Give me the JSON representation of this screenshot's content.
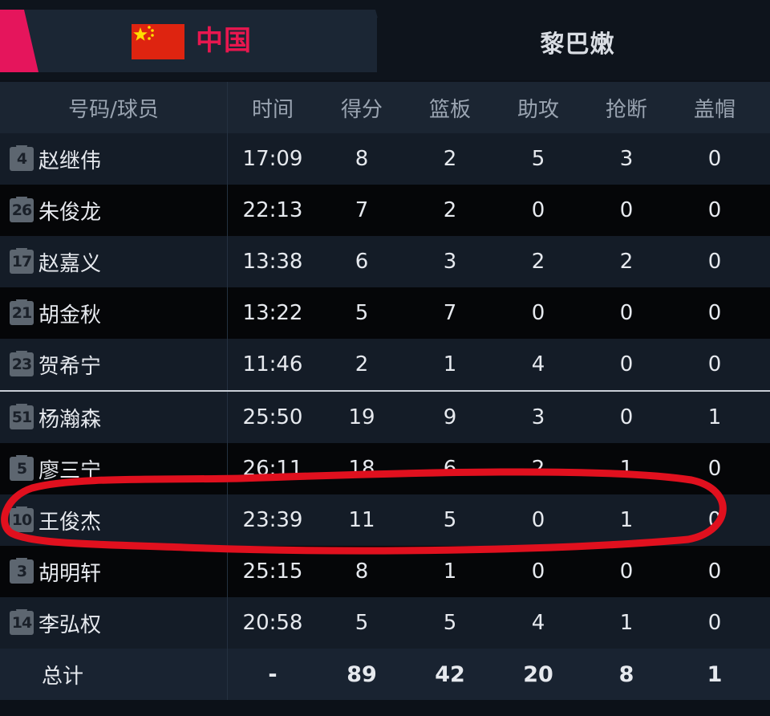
{
  "tabs": {
    "home": {
      "name": "中国",
      "flag": "china-flag"
    },
    "away": {
      "name": "黎巴嫩"
    }
  },
  "header": {
    "player": "号码/球员",
    "time": "时间",
    "points": "得分",
    "rebounds": "篮板",
    "assists": "助攻",
    "steals": "抢断",
    "blocks": "盖帽"
  },
  "starters": [
    {
      "number": "4",
      "name": "赵继伟",
      "time": "17:09",
      "points": "8",
      "rebounds": "2",
      "assists": "5",
      "steals": "3",
      "blocks": "0"
    },
    {
      "number": "26",
      "name": "朱俊龙",
      "time": "22:13",
      "points": "7",
      "rebounds": "2",
      "assists": "0",
      "steals": "0",
      "blocks": "0"
    },
    {
      "number": "17",
      "name": "赵嘉义",
      "time": "13:38",
      "points": "6",
      "rebounds": "3",
      "assists": "2",
      "steals": "2",
      "blocks": "0"
    },
    {
      "number": "21",
      "name": "胡金秋",
      "time": "13:22",
      "points": "5",
      "rebounds": "7",
      "assists": "0",
      "steals": "0",
      "blocks": "0"
    },
    {
      "number": "23",
      "name": "贺希宁",
      "time": "11:46",
      "points": "2",
      "rebounds": "1",
      "assists": "4",
      "steals": "0",
      "blocks": "0"
    }
  ],
  "bench": [
    {
      "number": "51",
      "name": "杨瀚森",
      "time": "25:50",
      "points": "19",
      "rebounds": "9",
      "assists": "3",
      "steals": "0",
      "blocks": "1"
    },
    {
      "number": "5",
      "name": "廖三宁",
      "time": "26:11",
      "points": "18",
      "rebounds": "6",
      "assists": "2",
      "steals": "1",
      "blocks": "0"
    },
    {
      "number": "10",
      "name": "王俊杰",
      "time": "23:39",
      "points": "11",
      "rebounds": "5",
      "assists": "0",
      "steals": "1",
      "blocks": "0"
    },
    {
      "number": "3",
      "name": "胡明轩",
      "time": "25:15",
      "points": "8",
      "rebounds": "1",
      "assists": "0",
      "steals": "0",
      "blocks": "0"
    },
    {
      "number": "14",
      "name": "李弘权",
      "time": "20:58",
      "points": "5",
      "rebounds": "5",
      "assists": "4",
      "steals": "1",
      "blocks": "0"
    }
  ],
  "totals": {
    "label": "总计",
    "time": "-",
    "points": "89",
    "rebounds": "42",
    "assists": "20",
    "steals": "8",
    "blocks": "1"
  },
  "colors": {
    "accent": "#e5155c",
    "home_name": "#e8174f",
    "annotation": "#e0101e"
  }
}
